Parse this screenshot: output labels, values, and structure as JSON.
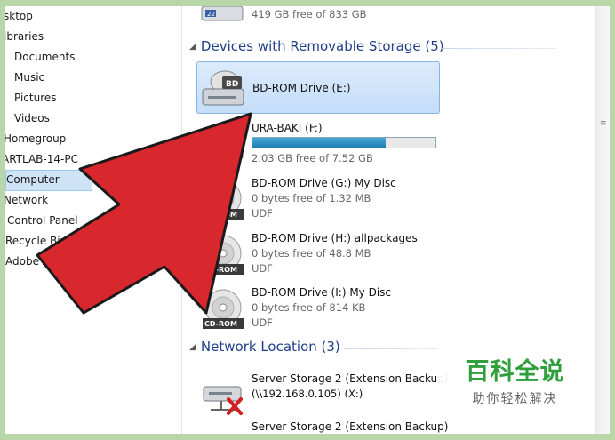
{
  "nav": {
    "items": [
      {
        "label": "sktop"
      },
      {
        "label": "ibraries"
      },
      {
        "label": "Documents"
      },
      {
        "label": "Music"
      },
      {
        "label": "Pictures"
      },
      {
        "label": "Videos"
      },
      {
        "label": "Homegroup"
      },
      {
        "label": "ARTLAB-14-PC"
      },
      {
        "label": "Computer"
      },
      {
        "label": "Network"
      },
      {
        "label": "Control Panel"
      },
      {
        "label": "Recycle Bin"
      },
      {
        "label": "Adobe Acrobat"
      }
    ]
  },
  "top_partial_drive": {
    "free": "419 GB free of 833 GB",
    "usage": 0.497
  },
  "removable": {
    "header": "Devices with Removable Storage (5)",
    "drives": [
      {
        "name": "BD-ROM Drive (E:)",
        "icon": "bd-drive-icon",
        "badge": "BD"
      },
      {
        "name": "URA-BAKI (F:)",
        "free": "2.03 GB free of 7.52 GB",
        "usage": 0.73,
        "icon": "usb-drive-icon"
      },
      {
        "name": "BD-ROM Drive (G:) My Disc",
        "free": "0 bytes free of 1.32 MB",
        "fs": "UDF",
        "icon": "cd-rom-disc-icon",
        "badge": "CD-ROM"
      },
      {
        "name": "BD-ROM Drive (H:) allpackages",
        "free": "0 bytes free of 48.8 MB",
        "fs": "UDF",
        "icon": "cd-rom-disc-icon",
        "badge": "CD-ROM"
      },
      {
        "name": "BD-ROM Drive (I:) My Disc",
        "free": "0 bytes free of 814 KB",
        "fs": "UDF",
        "icon": "cd-rom-disc-icon",
        "badge": "CD-ROM"
      }
    ]
  },
  "network": {
    "header": "Network Location (3)",
    "drives": [
      {
        "name": "Server Storage 2 (Extension Backup)",
        "path": "(\\\\192.168.0.105) (X:)",
        "icon": "disconnected-network-drive-icon"
      },
      {
        "name": "Server Storage 2 (Extension Backup)"
      }
    ]
  },
  "watermark": {
    "title": "百科全说",
    "subtitle": "助你轻松解决"
  },
  "colors": {
    "arrow": "#d8282e",
    "header": "#1e3f87",
    "selection": "#c4ddf9",
    "bar_fill": "#1d7fb3"
  }
}
